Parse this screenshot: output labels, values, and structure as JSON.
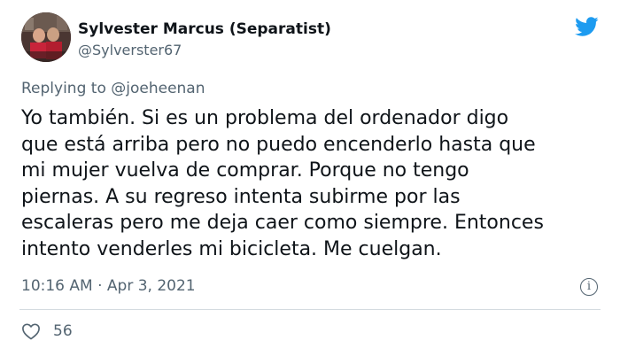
{
  "tweet": {
    "display_name": "Sylvester Marcus (Separatist)",
    "handle": "@Sylverster67",
    "reply_prefix": "Replying to ",
    "reply_mention": "@joeheenan",
    "text": "Yo también. Si es un problema del ordenador digo\nque está arriba pero no puedo encenderlo hasta que\nmi mujer vuelva de comprar. Porque no tengo\npiernas. A su regreso intenta subirme por las\nescaleras pero me deja caer como siempre. Entonces\nintento venderles mi bicicleta. Me cuelgan.",
    "timestamp": "10:16 AM · Apr 3, 2021",
    "like_count": "56"
  },
  "icons": {
    "brand": "twitter-bird-icon",
    "info": "info-icon",
    "like": "heart-icon"
  },
  "colors": {
    "brand_blue": "#1d9bf0",
    "text": "#0f1419",
    "secondary": "#536471"
  }
}
